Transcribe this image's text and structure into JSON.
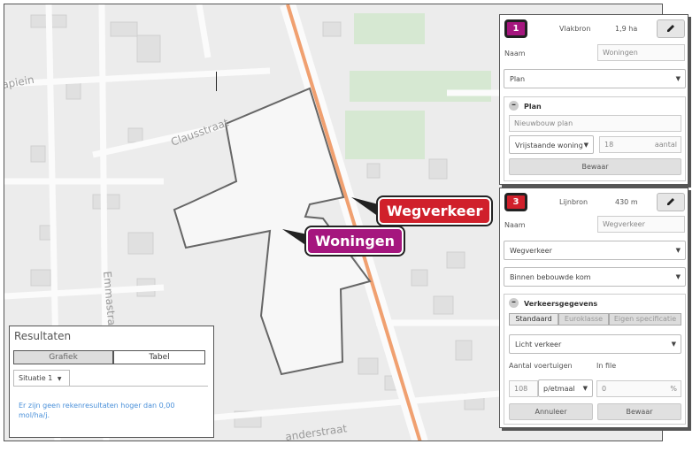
{
  "map": {
    "street_labels": [
      "apiein",
      "Clausstraat",
      "Emmastra",
      "anderstraat"
    ]
  },
  "labels": {
    "wegverkeer": "Wegverkeer",
    "woningen": "Woningen"
  },
  "source1": {
    "badge": "1",
    "type": "Vlakbron",
    "value": "1,9 ha",
    "naam_label": "Naam",
    "naam_value": "Woningen",
    "category": "Plan",
    "section_title": "Plan",
    "plan_placeholder": "Nieuwbouw plan",
    "housing_type": "Vrijstaande woning",
    "amount": "18",
    "amount_unit": "aantal",
    "save": "Bewaar"
  },
  "source3": {
    "badge": "3",
    "type": "Lijnbron",
    "value": "430 m",
    "naam_label": "Naam",
    "naam_value": "Wegverkeer",
    "category": "Wegverkeer",
    "subcategory": "Binnen bebouwde kom",
    "section_title": "Verkeersgegevens",
    "segments": [
      "Standaard",
      "Euroklasse",
      "Eigen specificatie"
    ],
    "vehicle_type": "Licht verkeer",
    "count_label": "Aantal voertuigen",
    "infile_label": "In file",
    "count_value": "108",
    "count_unit": "p/etmaal",
    "infile_value": "0",
    "infile_unit": "%",
    "cancel": "Annuleer",
    "save": "Bewaar"
  },
  "results": {
    "title": "Resultaten",
    "toggle_grafiek": "Grafiek",
    "toggle_tabel": "Tabel",
    "situation_tab": "Situatie 1",
    "message": "Er zijn geen rekenresultaten hoger dan 0,00 mol/ha/j."
  },
  "colors": {
    "wegverkeer": "#d0202b",
    "woningen": "#a5167e",
    "road": "#f0a070",
    "link": "#4a90d9"
  }
}
